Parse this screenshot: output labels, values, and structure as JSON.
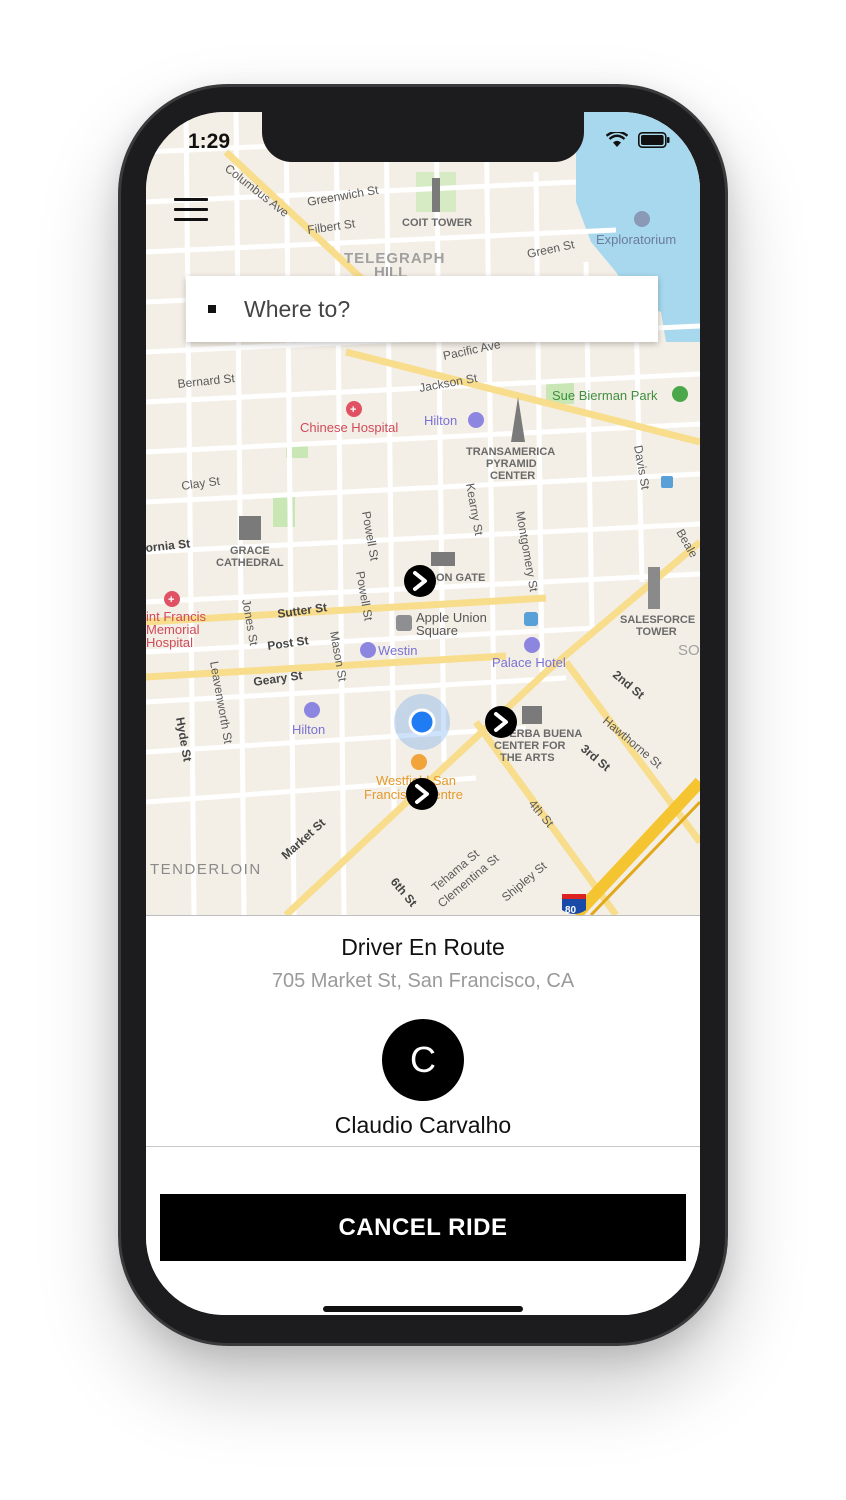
{
  "status": {
    "time": "1:29"
  },
  "search": {
    "placeholder": "Where to?"
  },
  "map": {
    "labels": {
      "columbus": "Columbus Ave",
      "greenwich": "Greenwich St",
      "filbert": "Filbert St",
      "coit": "COIT TOWER",
      "telegraph": "TELEGRAPH",
      "hill": "HILL",
      "green": "Green St",
      "exploratorium": "Exploratorium",
      "pacific": "Pacific Ave",
      "bernard": "Bernard St",
      "jackson": "Jackson St",
      "sue_bierman": "Sue Bierman Park",
      "chinese_hospital": "Chinese Hospital",
      "hilton_north": "Hilton",
      "transamerica1": "TRANSAMERICA",
      "transamerica2": "PYRAMID",
      "transamerica3": "CENTER",
      "clay": "Clay St",
      "grace1": "GRACE",
      "grace2": "CATHEDRAL",
      "california": "ornia St",
      "dragon_gate": "ON GATE",
      "powell": "Powell St",
      "kearny": "Kearny St",
      "montgomery": "Montgomery St",
      "davis": "Davis St",
      "beale": "Beale",
      "st_francis1": "int Francis",
      "st_francis2": "Memorial",
      "st_francis3": "Hospital",
      "sutter": "Sutter St",
      "apple1": "Apple Union",
      "apple2": "Square",
      "salesforce1": "SALESFORCE",
      "salesforce2": "TOWER",
      "jones": "Jones St",
      "post": "Post St",
      "westin": "Westin",
      "palace": "Palace Hotel",
      "mason": "Mason St",
      "leavenworth": "Leavenworth St",
      "geary": "Geary St",
      "second": "2nd St",
      "hilton_south": "Hilton",
      "hyde": "Hyde St",
      "yerba1": "YERBA BUENA",
      "yerba2": "CENTER FOR",
      "yerba3": "THE ARTS",
      "hawthorne": "Hawthorne St",
      "third": "3rd St",
      "westfield1": "Westfield San",
      "westfield2": "Francisco Centre",
      "fourth": "4th St",
      "market": "Market St",
      "tenderloin": "TENDERLOIN",
      "tehama": "Tehama St",
      "clementina": "Clementina St",
      "shipley": "Shipley St",
      "sixth": "6th St",
      "interstate": "80",
      "so": "SO"
    }
  },
  "sheet": {
    "status_title": "Driver En Route",
    "address": "705 Market St, San Francisco, CA",
    "avatar_initial": "C",
    "driver_name": "Claudio Carvalho",
    "cancel_label": "CANCEL RIDE"
  },
  "colors": {
    "accent": "#1f7cf2",
    "button": "#000000",
    "water": "#a8d8ee",
    "park": "#c9e6b5"
  }
}
